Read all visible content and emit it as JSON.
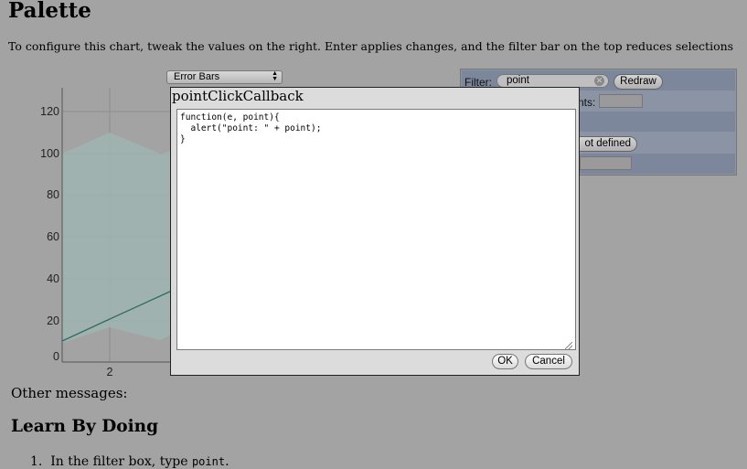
{
  "page": {
    "title": "Palette",
    "intro": "To configure this chart, tweak the values on the right. Enter applies changes, and the filter bar on the top reduces selections"
  },
  "chart_select": {
    "selected": "Error Bars"
  },
  "chart": {
    "y_ticks": [
      "120",
      "100",
      "80",
      "60",
      "40",
      "20",
      "0"
    ],
    "x_ticks": [
      "2"
    ],
    "colors": {
      "band": "#9fb5b1",
      "line": "#2e6e5e",
      "grid": "#8e8e8e"
    }
  },
  "panel": {
    "filter_label": "Filter:",
    "filter_value": "point",
    "redraw_label": "Redraw",
    "row2_label_partial": "nts:",
    "row4_button_partial": "ot defined"
  },
  "dialog": {
    "title": "pointClickCallback",
    "code": "function(e, point){\n  alert(\"point: \" + point);\n}",
    "ok_label": "OK",
    "cancel_label": "Cancel"
  },
  "below": {
    "other_messages": "Other messages:",
    "heading": "Learn By Doing",
    "step1_prefix": "In the filter box, type ",
    "step1_code": "point",
    "step1_suffix": "."
  }
}
